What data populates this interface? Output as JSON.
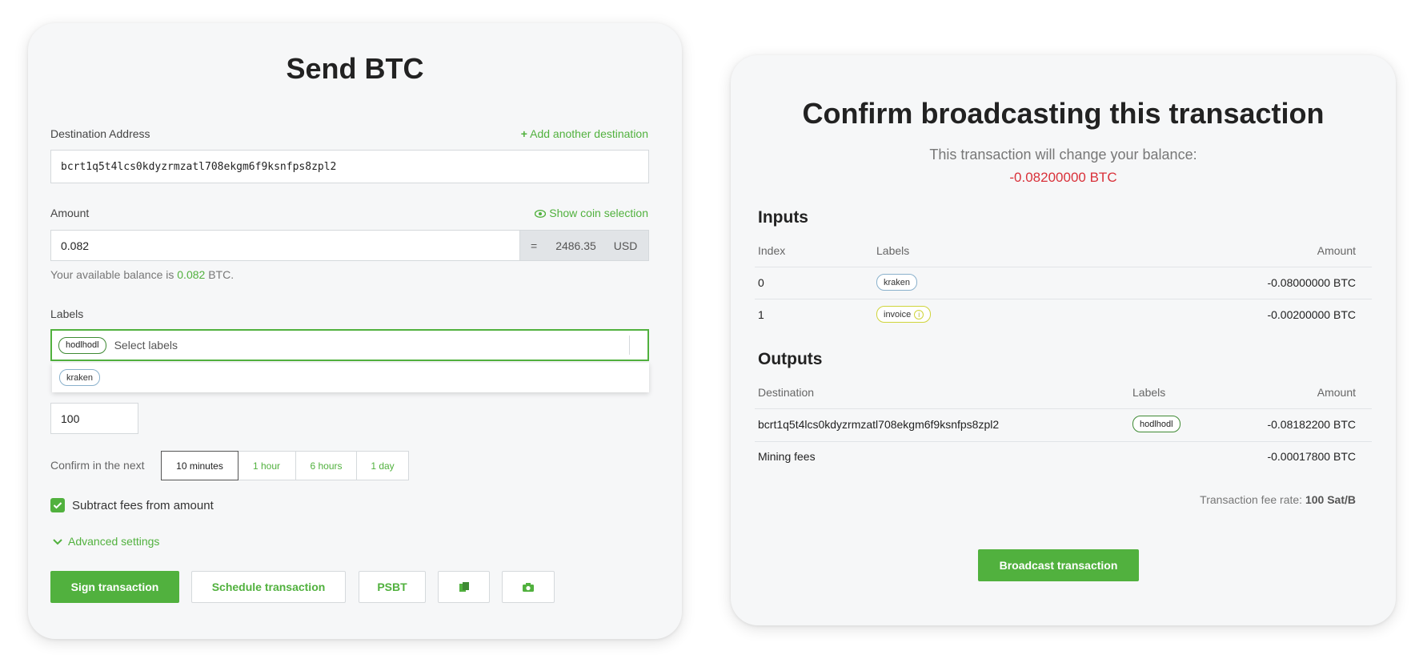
{
  "send": {
    "title": "Send BTC",
    "destination_label": "Destination Address",
    "add_destination": "Add another destination",
    "destination_value": "bcrt1q5t4lcs0kdyzrmzatl708ekgm6f9ksnfps8zpl2",
    "amount_label": "Amount",
    "show_coin_selection": "Show coin selection",
    "amount_value": "0.082",
    "equals": "=",
    "fiat_value": "2486.35",
    "fiat_currency": "USD",
    "balance_prefix": "Your available balance is ",
    "balance_value": "0.082",
    "balance_suffix": " BTC.",
    "labels_label": "Labels",
    "selected_label": "hodlhodl",
    "labels_placeholder": "Select labels",
    "dropdown_option": "kraken",
    "fee_rate_value": "100",
    "confirm_label": "Confirm in the next",
    "confirm_options": [
      "10 minutes",
      "1 hour",
      "6 hours",
      "1 day"
    ],
    "subtract_fees_label": "Subtract fees from amount",
    "advanced_settings": "Advanced settings",
    "buttons": {
      "sign": "Sign transaction",
      "schedule": "Schedule transaction",
      "psbt": "PSBT"
    }
  },
  "confirm": {
    "title": "Confirm broadcasting this transaction",
    "balance_change_text": "This transaction will change your balance:",
    "balance_change_value": "-0.08200000 BTC",
    "inputs_title": "Inputs",
    "inputs_headers": {
      "index": "Index",
      "labels": "Labels",
      "amount": "Amount"
    },
    "inputs": [
      {
        "index": "0",
        "label": "kraken",
        "amount": "-0.08000000 BTC"
      },
      {
        "index": "1",
        "label": "invoice",
        "amount": "-0.00200000 BTC"
      }
    ],
    "outputs_title": "Outputs",
    "outputs_headers": {
      "destination": "Destination",
      "labels": "Labels",
      "amount": "Amount"
    },
    "outputs": [
      {
        "destination": "bcrt1q5t4lcs0kdyzrmzatl708ekgm6f9ksnfps8zpl2",
        "label": "hodlhodl",
        "amount": "-0.08182200 BTC"
      },
      {
        "destination": "Mining fees",
        "label": "",
        "amount": "-0.00017800 BTC"
      }
    ],
    "fee_rate_label": "Transaction fee rate: ",
    "fee_rate_value": "100 Sat/B",
    "broadcast_button": "Broadcast transaction"
  },
  "colors": {
    "accent": "#51b13e",
    "negative": "#d9313a"
  }
}
